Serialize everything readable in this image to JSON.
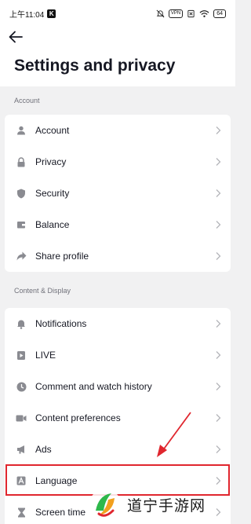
{
  "status_bar": {
    "time": "上午11:04",
    "app_badge": "K",
    "vpn_label": "VPN",
    "battery_level": "64"
  },
  "header": {
    "title": "Settings and privacy"
  },
  "sections": [
    {
      "label": "Account",
      "items": [
        {
          "label": "Account",
          "icon": "person-icon"
        },
        {
          "label": "Privacy",
          "icon": "lock-icon"
        },
        {
          "label": "Security",
          "icon": "shield-icon"
        },
        {
          "label": "Balance",
          "icon": "wallet-icon"
        },
        {
          "label": "Share profile",
          "icon": "share-arrow-icon"
        }
      ]
    },
    {
      "label": "Content & Display",
      "items": [
        {
          "label": "Notifications",
          "icon": "bell-icon"
        },
        {
          "label": "LIVE",
          "icon": "live-icon"
        },
        {
          "label": "Comment and watch history",
          "icon": "clock-icon"
        },
        {
          "label": "Content preferences",
          "icon": "video-camera-icon"
        },
        {
          "label": "Ads",
          "icon": "megaphone-icon"
        },
        {
          "label": "Language",
          "icon": "language-icon"
        },
        {
          "label": "Screen time",
          "icon": "hourglass-icon"
        }
      ]
    }
  ],
  "annotation": {
    "highlight_color": "#e0262e",
    "highlighted_item": "Language"
  },
  "watermark": {
    "text": "道宁手游网"
  },
  "colors": {
    "background": "#f1f1f2",
    "card": "#ffffff",
    "text_primary": "#161823",
    "text_secondary": "#70717a",
    "icon": "#8a8b91"
  }
}
